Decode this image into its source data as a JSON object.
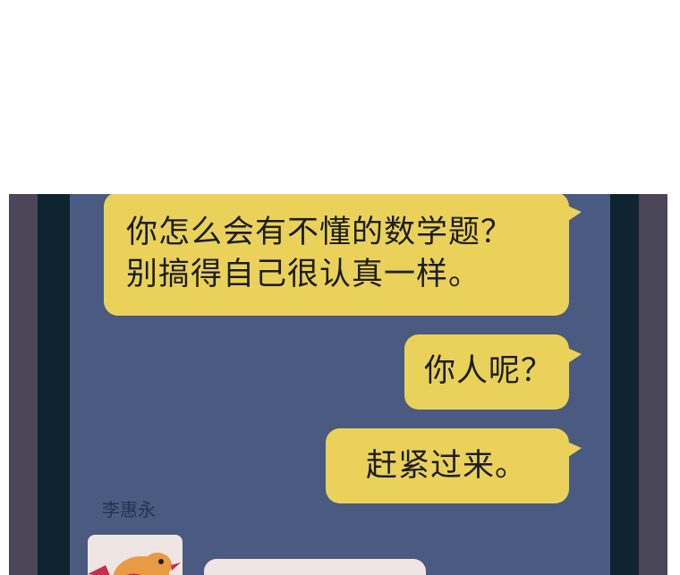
{
  "chat": {
    "messages": [
      {
        "side": "right",
        "lines": [
          "你怎么会有不懂的数学题？",
          "别搞得自己很认真一样。"
        ]
      },
      {
        "side": "right",
        "lines": [
          "你人呢？"
        ]
      },
      {
        "side": "right",
        "lines": [
          "赶紧过来。"
        ]
      }
    ],
    "incoming": {
      "sender_name": "李惠永",
      "avatar_icon": "bird-avatar-icon"
    }
  },
  "colors": {
    "outgoing_bubble": "#ead25a",
    "incoming_bubble": "#efe6e3",
    "screen_background": "#4a5a80",
    "bezel": "#0f2330",
    "frame": "#4b4658"
  }
}
